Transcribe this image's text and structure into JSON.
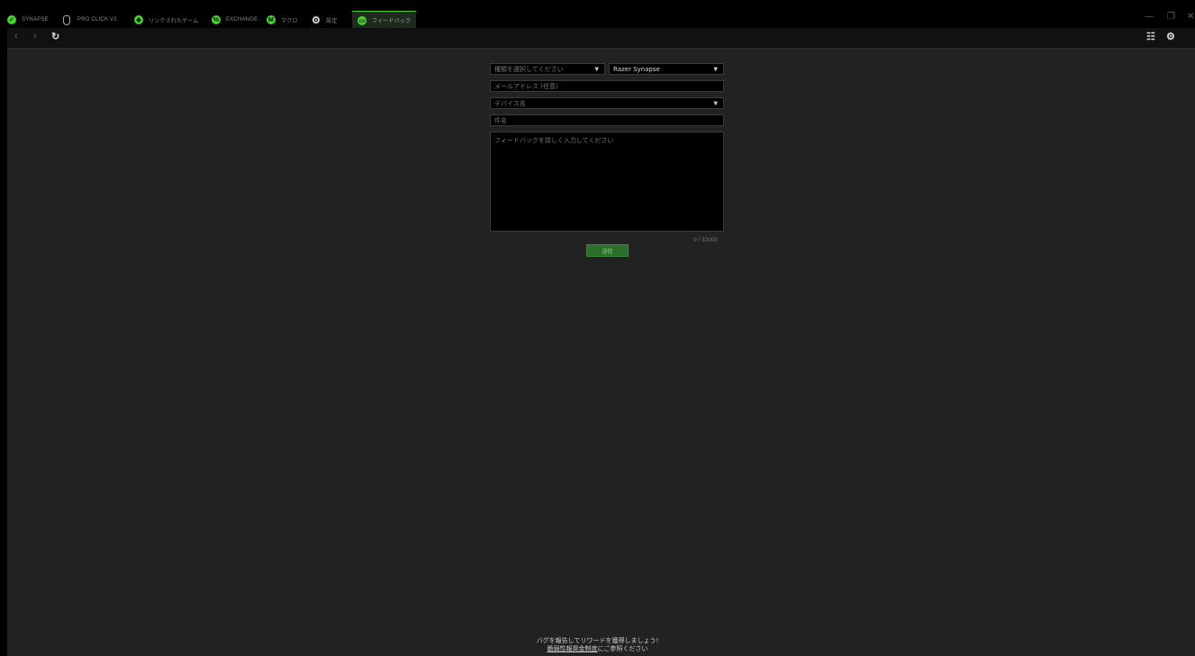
{
  "tabs": [
    {
      "label": "SYNAPSE",
      "icon": "razer-logo-icon"
    },
    {
      "label": "PRO CLICK V2",
      "icon": "mouse-icon"
    },
    {
      "label": "リンクされたゲーム",
      "icon": "gamepad-icon"
    },
    {
      "label": "EXCHANGE",
      "icon": "exchange-icon"
    },
    {
      "label": "マクロ",
      "icon": "macro-icon"
    },
    {
      "label": "設定",
      "icon": "gear-icon"
    },
    {
      "label": "フィードバック",
      "icon": "feedback-icon"
    }
  ],
  "active_tab": "フィードバック",
  "window_controls": {
    "minimize": "—",
    "restore": "❐",
    "close": "✕"
  },
  "nav": {
    "back": "‹",
    "forward": "›",
    "refresh": "↻",
    "apps": "☷",
    "settings": "⚙"
  },
  "form": {
    "category_placeholder": "種類を選択してください",
    "product_value": "Razer Synapse",
    "email_placeholder": "メールアドレス (任意)",
    "device_placeholder": "デバイス名",
    "subject_placeholder": "件名",
    "feedback_placeholder": "フィードバックを詳しく入力してください",
    "char_counter": "0 / 32000",
    "send_label": "送信"
  },
  "footer": {
    "line1": "バグを報告してリワードを獲得しましょう!",
    "link": "脆弱性報奨金制度",
    "line2_suffix": "にご参照ください"
  },
  "colors": {
    "accent": "#44d62c",
    "background": "#222222",
    "button": "#2b6e2b"
  }
}
